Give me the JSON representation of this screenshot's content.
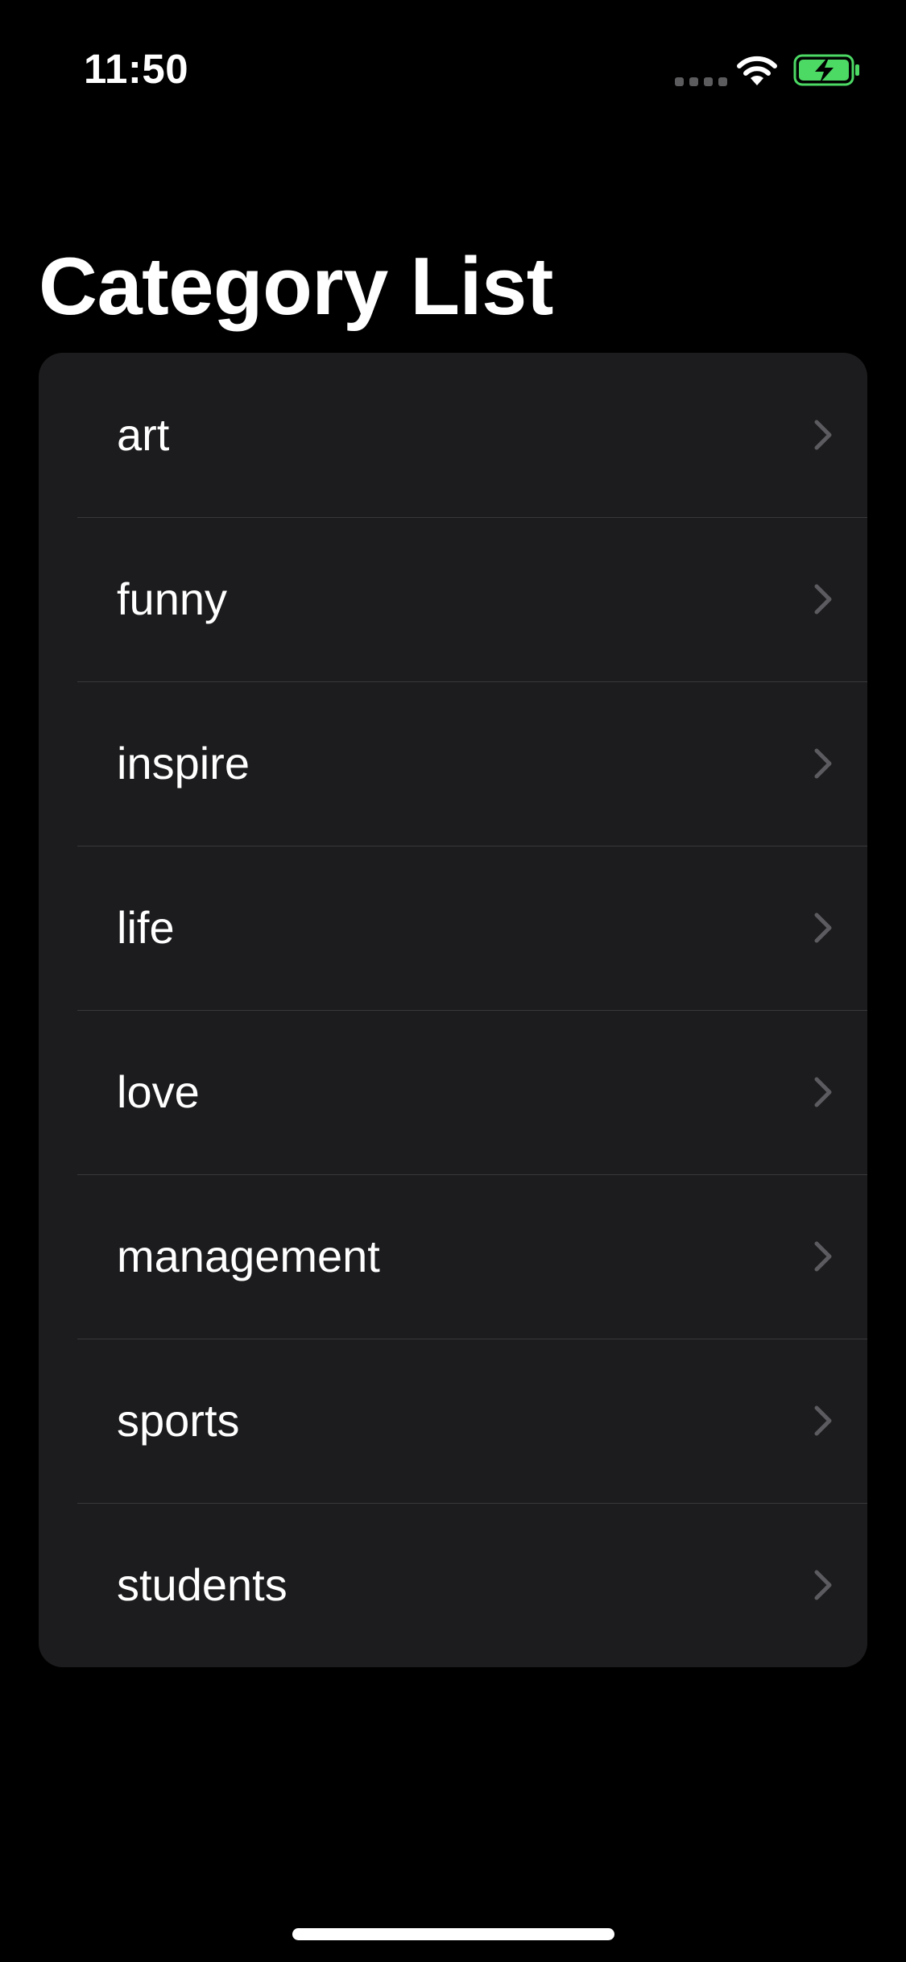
{
  "status_bar": {
    "time": "11:50",
    "icons": [
      "cellular-signal-icon",
      "wifi-icon",
      "battery-charging-icon"
    ],
    "battery_color": "#4cd964"
  },
  "header": {
    "title": "Category List"
  },
  "list": {
    "items": [
      {
        "label": "art",
        "icon": "chevron-right-icon"
      },
      {
        "label": "funny",
        "icon": "chevron-right-icon"
      },
      {
        "label": "inspire",
        "icon": "chevron-right-icon"
      },
      {
        "label": "life",
        "icon": "chevron-right-icon"
      },
      {
        "label": "love",
        "icon": "chevron-right-icon"
      },
      {
        "label": "management",
        "icon": "chevron-right-icon"
      },
      {
        "label": "sports",
        "icon": "chevron-right-icon"
      },
      {
        "label": "students",
        "icon": "chevron-right-icon"
      }
    ]
  },
  "colors": {
    "background": "#000000",
    "card": "#1c1c1e",
    "separator": "#38383a",
    "chevron": "#5c5c60",
    "text": "#ffffff"
  }
}
